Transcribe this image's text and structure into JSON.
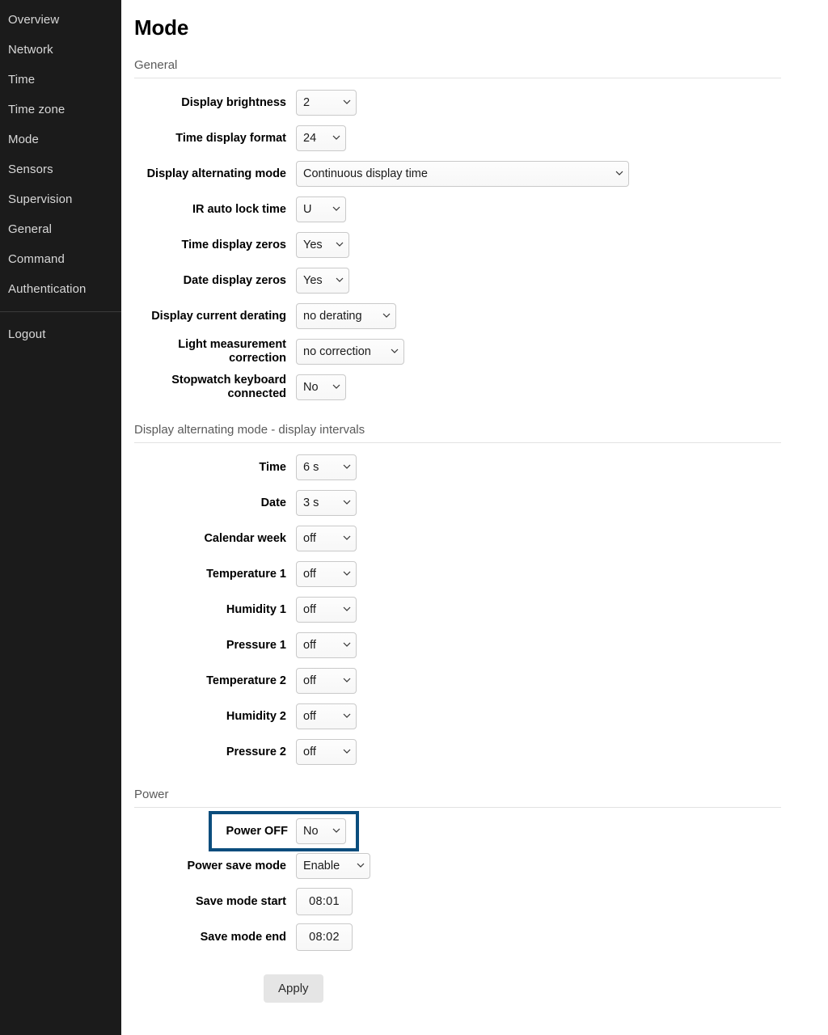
{
  "sidebar": {
    "items": [
      {
        "label": "Overview"
      },
      {
        "label": "Network"
      },
      {
        "label": "Time"
      },
      {
        "label": "Time zone"
      },
      {
        "label": "Mode"
      },
      {
        "label": "Sensors"
      },
      {
        "label": "Supervision"
      },
      {
        "label": "General"
      },
      {
        "label": "Command"
      },
      {
        "label": "Authentication"
      }
    ],
    "logout_label": "Logout"
  },
  "page": {
    "title": "Mode"
  },
  "sections": {
    "general": {
      "heading": "General",
      "fields": [
        {
          "label": "Display brightness",
          "value": "2"
        },
        {
          "label": "Time display format",
          "value": "24"
        },
        {
          "label": "Display alternating mode",
          "value": "Continuous display time"
        },
        {
          "label": "IR auto lock time",
          "value": "U"
        },
        {
          "label": "Time display zeros",
          "value": "Yes"
        },
        {
          "label": "Date display zeros",
          "value": "Yes"
        },
        {
          "label": "Display current derating",
          "value": "no derating"
        },
        {
          "label": "Light measurement correction",
          "value": "no correction"
        },
        {
          "label": "Stopwatch keyboard connected",
          "value": "No"
        }
      ]
    },
    "intervals": {
      "heading": "Display alternating mode - display intervals",
      "fields": [
        {
          "label": "Time",
          "value": "6 s"
        },
        {
          "label": "Date",
          "value": "3 s"
        },
        {
          "label": "Calendar week",
          "value": "off"
        },
        {
          "label": "Temperature 1",
          "value": "off"
        },
        {
          "label": "Humidity 1",
          "value": "off"
        },
        {
          "label": "Pressure 1",
          "value": "off"
        },
        {
          "label": "Temperature 2",
          "value": "off"
        },
        {
          "label": "Humidity 2",
          "value": "off"
        },
        {
          "label": "Pressure 2",
          "value": "off"
        }
      ]
    },
    "power": {
      "heading": "Power",
      "fields": [
        {
          "label": "Power OFF",
          "value": "No"
        },
        {
          "label": "Power save mode",
          "value": "Enable"
        },
        {
          "label": "Save mode start",
          "value": "08:01"
        },
        {
          "label": "Save mode end",
          "value": "08:02"
        }
      ]
    }
  },
  "actions": {
    "apply_label": "Apply"
  },
  "colors": {
    "sidebar_bg": "#1b1b1b",
    "sidebar_text": "#d8d8d8",
    "highlight_outline": "#0b4d7d",
    "section_rule": "#e2e2e2",
    "apply_bg": "#e5e5e5"
  }
}
